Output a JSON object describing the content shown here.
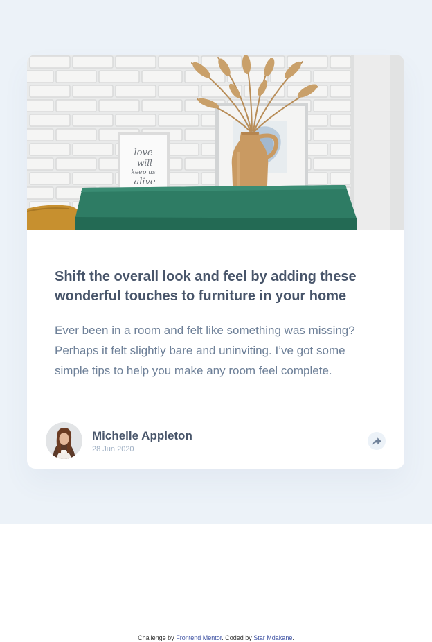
{
  "article": {
    "title": "Shift the overall look and feel by adding these wonderful touches to furniture in your home",
    "excerpt": "Ever been in a room and felt like something was missing? Perhaps it felt slightly bare and uninviting. I’ve got some simple tips to help you make any room feel complete.",
    "image_text": [
      "love",
      "will",
      "keep us",
      "alive"
    ]
  },
  "author": {
    "name": "Michelle Appleton",
    "date": "28 Jun 2020"
  },
  "icons": {
    "share": "share-arrow-icon"
  },
  "footer": {
    "prefix": "Challenge by",
    "link1": "Frontend Mentor",
    "middle": ". Coded by",
    "link2": "Star Mdakane",
    "suffix": "."
  },
  "colors": {
    "background": "#ecf2f8",
    "title": "#48556a",
    "body": "#6e8098",
    "muted": "#9daec2",
    "link": "#3e52a3"
  }
}
